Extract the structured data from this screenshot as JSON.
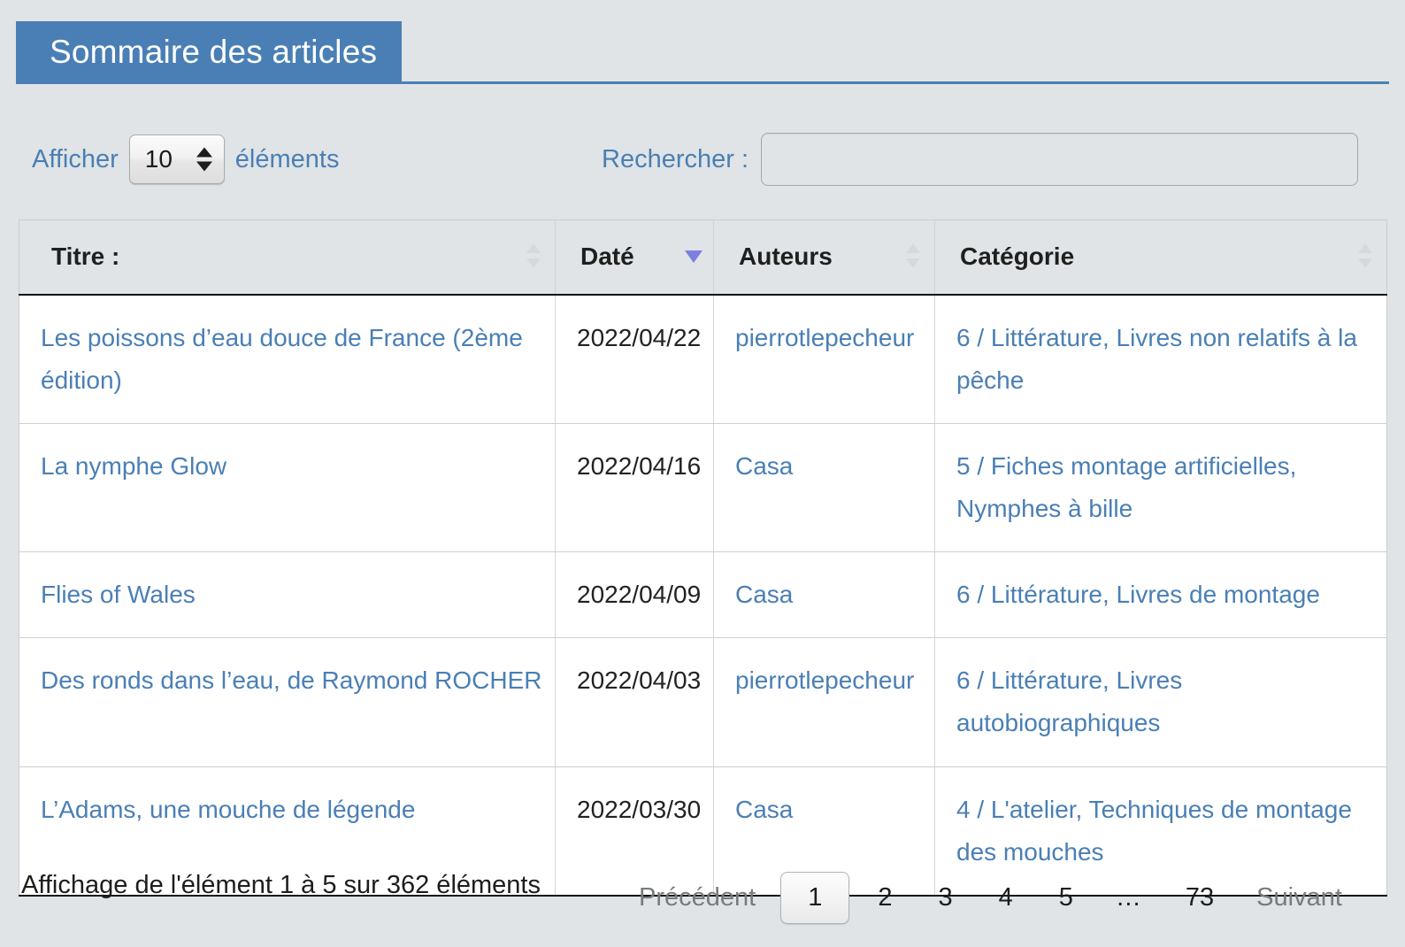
{
  "tab": {
    "label": "Sommaire des articles"
  },
  "controls": {
    "length_label_before": "Afficher",
    "length_value": "10",
    "length_label_after": "éléments",
    "search_label": "Rechercher :",
    "search_value": "",
    "search_placeholder": ""
  },
  "table": {
    "columns": [
      {
        "label": "Titre :",
        "sort": "none"
      },
      {
        "label": "Daté",
        "sort": "desc"
      },
      {
        "label": "Auteurs",
        "sort": "none"
      },
      {
        "label": "Catégorie",
        "sort": "none"
      }
    ],
    "rows": [
      {
        "titre": "Les poissons d’eau douce de France (2ème édition)",
        "date": "2022/04/22",
        "auteur": "pierrotlepecheur",
        "categorie_parts": [
          "6 / Littérature",
          "Livres non relatifs à la pêche"
        ]
      },
      {
        "titre": "La nymphe Glow",
        "date": "2022/04/16",
        "auteur": "Casa",
        "categorie_parts": [
          "5 / Fiches montage artificielles",
          "Nymphes à bille"
        ]
      },
      {
        "titre": "Flies of Wales",
        "date": "2022/04/09",
        "auteur": "Casa",
        "categorie_parts": [
          "6 / Littérature",
          "Livres de montage"
        ]
      },
      {
        "titre": "Des ronds dans l’eau, de Raymond ROCHER",
        "date": "2022/04/03",
        "auteur": "pierrotlepecheur",
        "categorie_parts": [
          "6 / Littérature",
          "Livres autobiographiques"
        ]
      },
      {
        "titre": "L’Adams, une mouche de légende",
        "date": "2022/03/30",
        "auteur": "Casa",
        "categorie_parts": [
          "4 / L'atelier",
          "Techniques de montage des mouches"
        ]
      }
    ]
  },
  "footer": {
    "info": "Affichage de l'élément 1 à 5 sur 362 éléments",
    "previous": "Précédent",
    "pages": [
      "1",
      "2",
      "3",
      "4",
      "5",
      "…",
      "73"
    ],
    "current_page": "1",
    "next": "Suivant"
  },
  "colors": {
    "accent": "#4a7fb5",
    "link": "#4a7fb5",
    "page_background": "#e0e4e6",
    "sort_active": "#7b7fe0",
    "border": "#cccccc"
  }
}
